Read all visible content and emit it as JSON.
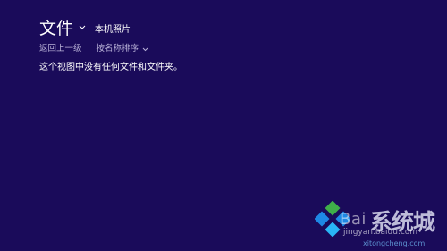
{
  "header": {
    "title": "文件",
    "location": "本机照片"
  },
  "toolbar": {
    "back_label": "返回上一级",
    "sort_label": "按名称排序"
  },
  "content": {
    "empty_message": "这个视图中没有任何文件和文件夹。"
  },
  "watermark": {
    "baidu_text": "Bai",
    "site_name": "系统城",
    "url_baidu": "jingyan.baidu.com",
    "url_site": "xitongcheng.com"
  },
  "colors": {
    "background": "#1a0b5a",
    "primary_text": "#ffffff",
    "secondary_text": "#b9b2d8"
  }
}
